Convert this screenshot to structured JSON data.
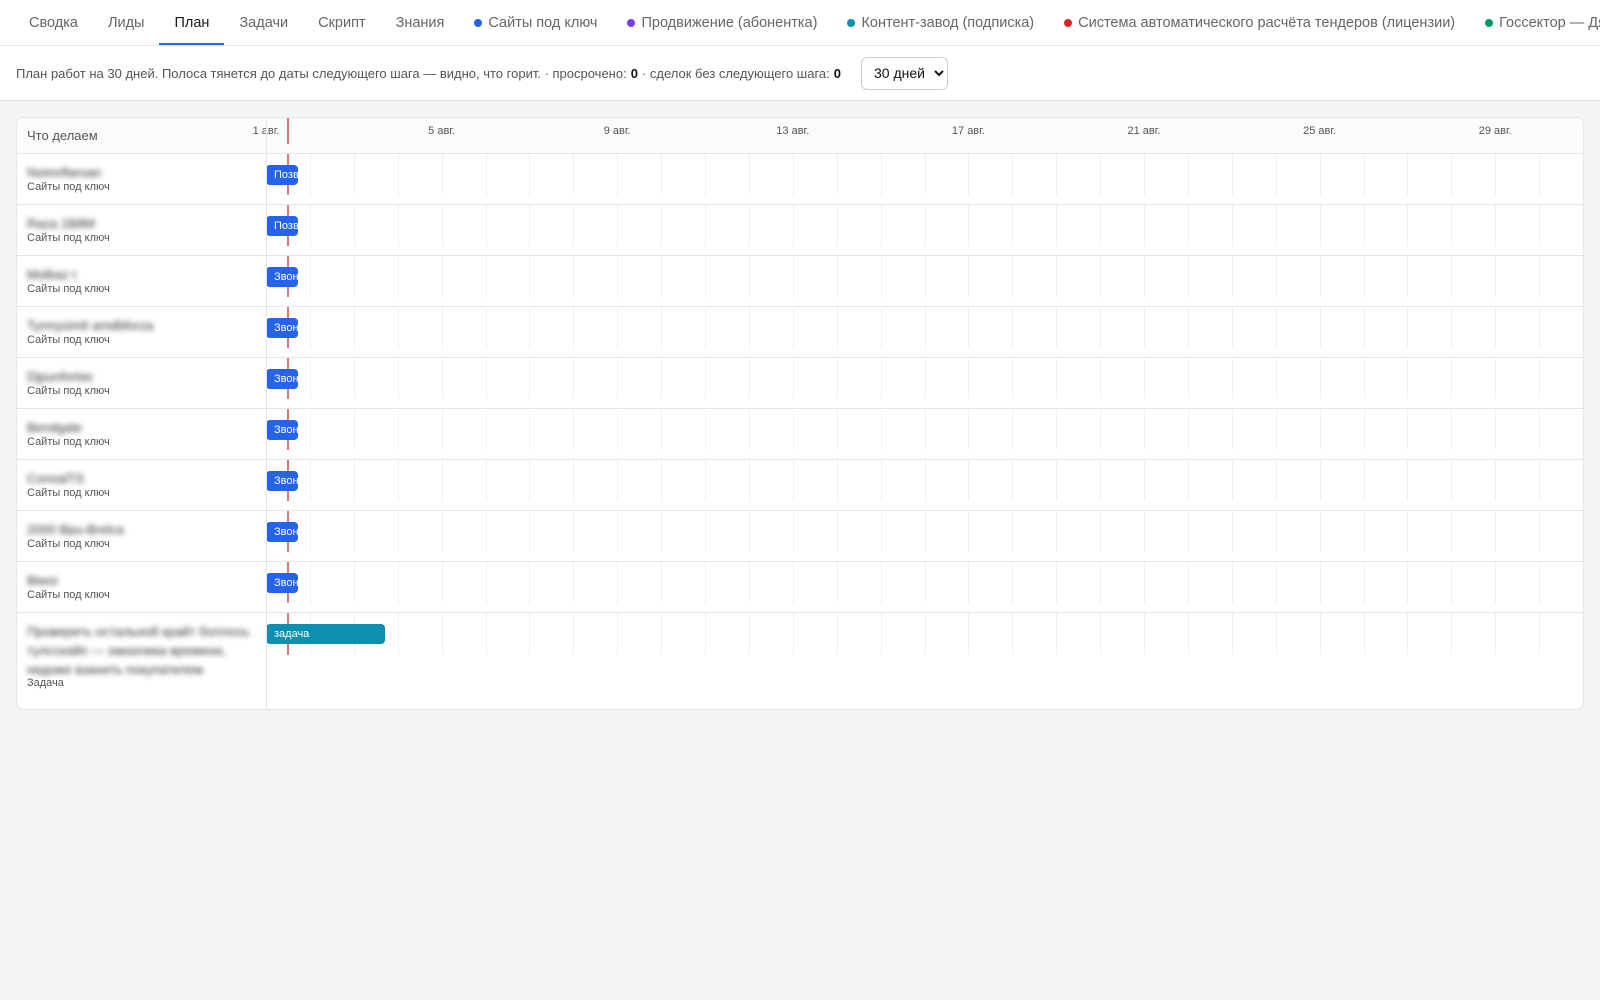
{
  "nav": {
    "tabs": [
      {
        "label": "Сводка",
        "active": false,
        "dot": null
      },
      {
        "label": "Лиды",
        "active": false,
        "dot": null
      },
      {
        "label": "План",
        "active": true,
        "dot": null
      },
      {
        "label": "Задачи",
        "active": false,
        "dot": null
      },
      {
        "label": "Скрипт",
        "active": false,
        "dot": null
      },
      {
        "label": "Знания",
        "active": false,
        "dot": null
      },
      {
        "label": "Сайты под ключ",
        "active": false,
        "dot": "#2563eb"
      },
      {
        "label": "Продвижение (абонентка)",
        "active": false,
        "dot": "#7c3aed"
      },
      {
        "label": "Контент-завод (подписка)",
        "active": false,
        "dot": "#0e8fb0"
      },
      {
        "label": "Система автоматического расчёта тендеров (лицензии)",
        "active": false,
        "dot": "#dc2626"
      },
      {
        "label": "Госсектор — Дядя",
        "active": false,
        "dot": "#059669"
      }
    ]
  },
  "info": {
    "text": "План работ на 30 дней. Полоса тянется до даты следующего шага — видно, что горит. · просрочено:",
    "overdue_count": "0",
    "no_step_label": "· сделок без следующего шага:",
    "no_step_count": "0",
    "period_select": "30 дней"
  },
  "gantt": {
    "header_label": "Что делаем",
    "date_labels": [
      "1 авг.",
      "5 авг.",
      "9 авг.",
      "13 авг.",
      "17 авг.",
      "21 авг.",
      "25 авг.",
      "29 авг."
    ],
    "days_total": 30,
    "today_day": 0.5,
    "rows": [
      {
        "title": "Noimrlfaroan",
        "subtitle": "Сайты под ключ",
        "bar_label": "Позвонить",
        "bar_start_day": 0,
        "bar_end_day": 0.72,
        "color": "blue"
      },
      {
        "title": "Raza 1B8M",
        "subtitle": "Сайты под ключ",
        "bar_label": "Позвонить",
        "bar_start_day": 0,
        "bar_end_day": 0.72,
        "color": "blue"
      },
      {
        "title": "Molbaz t",
        "subtitle": "Сайты под ключ",
        "bar_label": "Звонок",
        "bar_start_day": 0,
        "bar_end_day": 0.72,
        "color": "blue"
      },
      {
        "title": "Tyrmysimli amdbforza",
        "subtitle": "Сайты под ключ",
        "bar_label": "Звонок",
        "bar_start_day": 0,
        "bar_end_day": 0.72,
        "color": "blue"
      },
      {
        "title": "Djpunforlas",
        "subtitle": "Сайты под ключ",
        "bar_label": "Звонок",
        "bar_start_day": 0,
        "bar_end_day": 0.72,
        "color": "blue"
      },
      {
        "title": "Bendgale",
        "subtitle": "Сайты под ключ",
        "bar_label": "Звонок",
        "bar_start_day": 0,
        "bar_end_day": 0.72,
        "color": "blue"
      },
      {
        "title": "ConsalTS",
        "subtitle": "Сайты под ключ",
        "bar_label": "Звонок",
        "bar_start_day": 0,
        "bar_end_day": 0.72,
        "color": "blue"
      },
      {
        "title": "2000 Bpu-Brelca",
        "subtitle": "Сайты под ключ",
        "bar_label": "Звонок",
        "bar_start_day": 0,
        "bar_end_day": 0.72,
        "color": "blue"
      },
      {
        "title": "Biwsi",
        "subtitle": "Сайты под ключ",
        "bar_label": "Звонок",
        "bar_start_day": 0,
        "bar_end_day": 0.72,
        "color": "blue"
      },
      {
        "title": "Проверить остальной крайт боллось тулсскайп — заказчика времени, недоже взанить покупателем",
        "subtitle": "Задача",
        "bar_label": "задача",
        "bar_start_day": 0,
        "bar_end_day": 2.72,
        "color": "teal"
      }
    ]
  }
}
